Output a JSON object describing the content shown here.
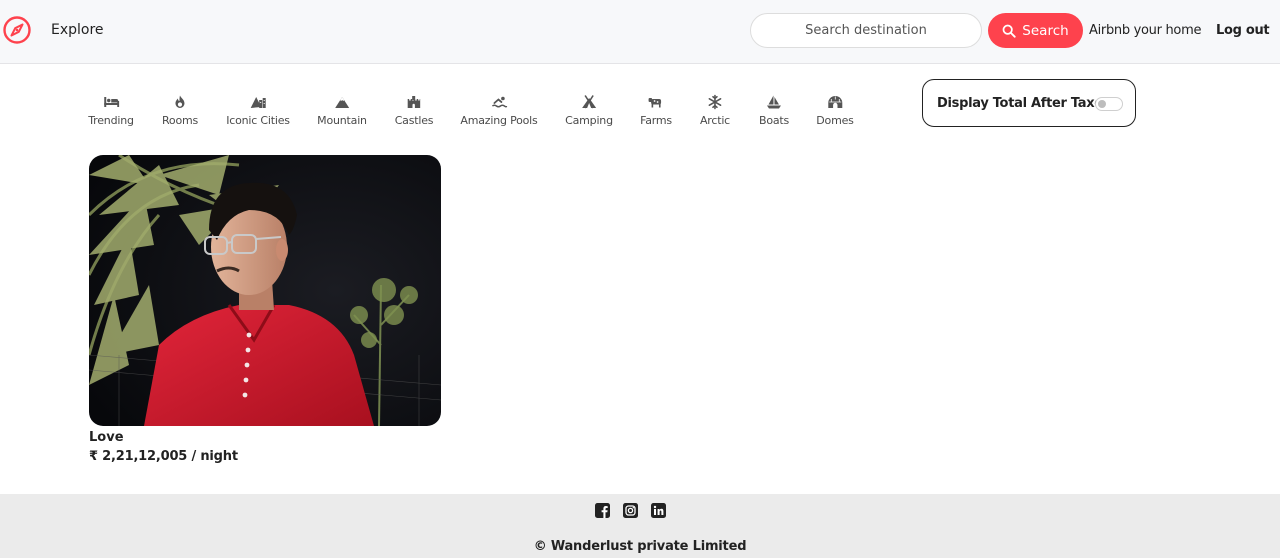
{
  "navbar": {
    "brand_icon": "compass-icon",
    "brand_color": "#fe424d",
    "explore_label": "Explore",
    "search_placeholder": "Search destination",
    "search_value": "",
    "search_button_label": "Search",
    "search_button_icon": "search-icon",
    "host_label": "Airbnb your home",
    "logout_label": "Log out"
  },
  "filters": [
    {
      "label": "Trending",
      "icon": "bed-icon"
    },
    {
      "label": "Rooms",
      "icon": "fire-icon"
    },
    {
      "label": "Iconic Cities",
      "icon": "mountain-city-icon"
    },
    {
      "label": "Mountain",
      "icon": "mountain-icon"
    },
    {
      "label": "Castles",
      "icon": "castle-icon"
    },
    {
      "label": "Amazing Pools",
      "icon": "swimmer-icon"
    },
    {
      "label": "Camping",
      "icon": "campground-icon"
    },
    {
      "label": "Farms",
      "icon": "cow-icon"
    },
    {
      "label": "Arctic",
      "icon": "snowflake-icon"
    },
    {
      "label": "Boats",
      "icon": "sailboat-icon"
    },
    {
      "label": "Domes",
      "icon": "igloo-icon"
    }
  ],
  "tax_toggle": {
    "label": "Display Total After Taxes",
    "enabled": false
  },
  "listings": [
    {
      "title": "Love",
      "price": "₹ 2,21,12,005 / night",
      "photo": "portrait-photo"
    }
  ],
  "footer": {
    "social_icons": [
      "facebook-icon",
      "instagram-icon",
      "linkedin-icon"
    ],
    "copyright": "© Wanderlust private Limited"
  },
  "colors": {
    "accent": "#fe424d",
    "navbar_bg": "#f7f8fa",
    "footer_bg": "#ebebeb",
    "text": "#222222"
  }
}
